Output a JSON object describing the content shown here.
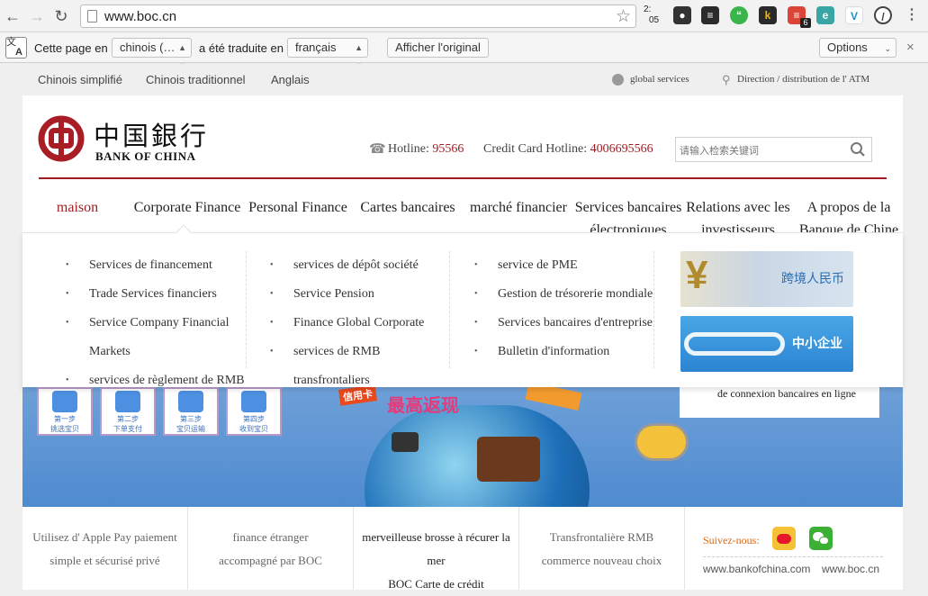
{
  "browser": {
    "url": "www.boc.cn",
    "clock": [
      "2:",
      "05"
    ],
    "extension_badge": "6"
  },
  "translate_bar": {
    "prefix": "Cette page en",
    "source_lang": "chinois (…",
    "middle": "a été traduite en",
    "target_lang": "français",
    "show_original": "Afficher l'original",
    "options": "Options",
    "close": "×"
  },
  "langbar": {
    "languages": [
      "Chinois simplifié",
      "Chinois traditionnel",
      "Anglais"
    ],
    "global_services": "global services",
    "atm": "Direction / distribution de l' ATM"
  },
  "header": {
    "logo_cn": "中国銀行",
    "logo_en": "BANK OF CHINA",
    "hotline_label": "Hotline:",
    "hotline_number": "95566",
    "cc_hotline_label": "Credit Card Hotline:",
    "cc_hotline_number": "4006695566",
    "search_placeholder": "请输入检索关键词"
  },
  "nav": [
    {
      "line1": "maison",
      "line2": ""
    },
    {
      "line1": "Corporate Finance",
      "line2": ""
    },
    {
      "line1": "Personal Finance",
      "line2": ""
    },
    {
      "line1": "Cartes bancaires",
      "line2": ""
    },
    {
      "line1": "marché financier",
      "line2": ""
    },
    {
      "line1": "Services bancaires",
      "line2": "électroniques"
    },
    {
      "line1": "Relations avec les",
      "line2": "investisseurs"
    },
    {
      "line1": "A propos de la",
      "line2": "Banque de Chine"
    }
  ],
  "dropdown": {
    "col1": [
      "Services de financement",
      "Trade Services financiers",
      "Service Company Financial",
      "Markets",
      "services de règlement de RMB"
    ],
    "col2": [
      "services de dépôt société",
      "Service Pension",
      "Finance Global Corporate",
      "services de RMB",
      "transfrontaliers"
    ],
    "col3": [
      "service de PME",
      "Gestion de trésorerie mondiale",
      "Services bancaires d'entreprise",
      "Bulletin d'information"
    ],
    "promo1": "跨境人民币",
    "promo2": "中小企业"
  },
  "banner": {
    "steps": [
      {
        "top": "第一步",
        "bottom": "挑选宝贝"
      },
      {
        "top": "第二步",
        "bottom": "下单支付"
      },
      {
        "top": "第三步",
        "bottom": "宝贝运输"
      },
      {
        "top": "第四步",
        "bottom": "收到宝贝"
      }
    ],
    "card_tag": "信用卡",
    "slogan": "最高返现",
    "side_text": "de connexion bancaires en ligne"
  },
  "bottom": {
    "cells": [
      {
        "line1": "Utilisez d' Apple Pay paiement",
        "line2": "simple et sécurisé privé",
        "line3": ""
      },
      {
        "line1": "finance étranger",
        "line2": "accompagné par BOC",
        "line3": ""
      },
      {
        "line1": "merveilleuse brosse à récurer la",
        "line2": "mer",
        "line3": "BOC Carte de crédit"
      },
      {
        "line1": "Transfrontalière RMB",
        "line2": "commerce nouveau choix",
        "line3": ""
      }
    ],
    "follow_label": "Suivez-nous:",
    "site1": "www.bankofchina.com",
    "site2": "www.boc.cn"
  }
}
